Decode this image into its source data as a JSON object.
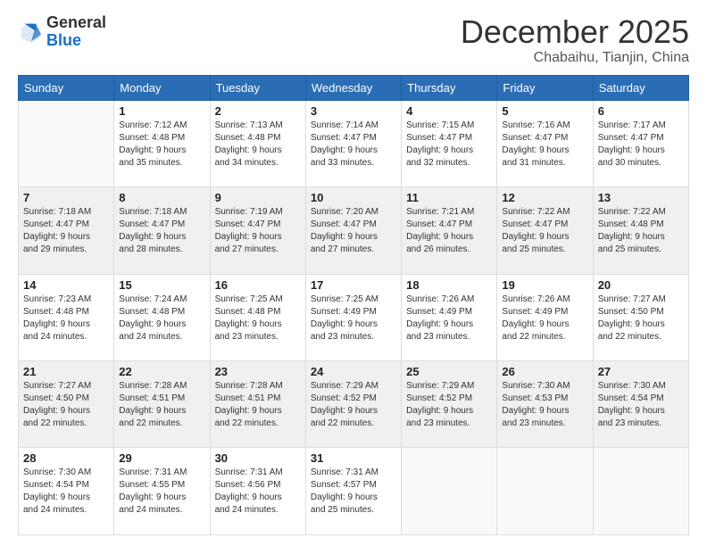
{
  "logo": {
    "general": "General",
    "blue": "Blue"
  },
  "title": "December 2025",
  "location": "Chabaihu, Tianjin, China",
  "weekdays": [
    "Sunday",
    "Monday",
    "Tuesday",
    "Wednesday",
    "Thursday",
    "Friday",
    "Saturday"
  ],
  "weeks": [
    [
      {
        "day": "",
        "empty": true
      },
      {
        "day": "1",
        "sunrise": "7:12 AM",
        "sunset": "4:48 PM",
        "daylight": "9 hours and 35 minutes."
      },
      {
        "day": "2",
        "sunrise": "7:13 AM",
        "sunset": "4:48 PM",
        "daylight": "9 hours and 34 minutes."
      },
      {
        "day": "3",
        "sunrise": "7:14 AM",
        "sunset": "4:47 PM",
        "daylight": "9 hours and 33 minutes."
      },
      {
        "day": "4",
        "sunrise": "7:15 AM",
        "sunset": "4:47 PM",
        "daylight": "9 hours and 32 minutes."
      },
      {
        "day": "5",
        "sunrise": "7:16 AM",
        "sunset": "4:47 PM",
        "daylight": "9 hours and 31 minutes."
      },
      {
        "day": "6",
        "sunrise": "7:17 AM",
        "sunset": "4:47 PM",
        "daylight": "9 hours and 30 minutes."
      }
    ],
    [
      {
        "day": "7",
        "sunrise": "7:18 AM",
        "sunset": "4:47 PM",
        "daylight": "9 hours and 29 minutes."
      },
      {
        "day": "8",
        "sunrise": "7:18 AM",
        "sunset": "4:47 PM",
        "daylight": "9 hours and 28 minutes."
      },
      {
        "day": "9",
        "sunrise": "7:19 AM",
        "sunset": "4:47 PM",
        "daylight": "9 hours and 27 minutes."
      },
      {
        "day": "10",
        "sunrise": "7:20 AM",
        "sunset": "4:47 PM",
        "daylight": "9 hours and 27 minutes."
      },
      {
        "day": "11",
        "sunrise": "7:21 AM",
        "sunset": "4:47 PM",
        "daylight": "9 hours and 26 minutes."
      },
      {
        "day": "12",
        "sunrise": "7:22 AM",
        "sunset": "4:47 PM",
        "daylight": "9 hours and 25 minutes."
      },
      {
        "day": "13",
        "sunrise": "7:22 AM",
        "sunset": "4:48 PM",
        "daylight": "9 hours and 25 minutes."
      }
    ],
    [
      {
        "day": "14",
        "sunrise": "7:23 AM",
        "sunset": "4:48 PM",
        "daylight": "9 hours and 24 minutes."
      },
      {
        "day": "15",
        "sunrise": "7:24 AM",
        "sunset": "4:48 PM",
        "daylight": "9 hours and 24 minutes."
      },
      {
        "day": "16",
        "sunrise": "7:25 AM",
        "sunset": "4:48 PM",
        "daylight": "9 hours and 23 minutes."
      },
      {
        "day": "17",
        "sunrise": "7:25 AM",
        "sunset": "4:49 PM",
        "daylight": "9 hours and 23 minutes."
      },
      {
        "day": "18",
        "sunrise": "7:26 AM",
        "sunset": "4:49 PM",
        "daylight": "9 hours and 23 minutes."
      },
      {
        "day": "19",
        "sunrise": "7:26 AM",
        "sunset": "4:49 PM",
        "daylight": "9 hours and 22 minutes."
      },
      {
        "day": "20",
        "sunrise": "7:27 AM",
        "sunset": "4:50 PM",
        "daylight": "9 hours and 22 minutes."
      }
    ],
    [
      {
        "day": "21",
        "sunrise": "7:27 AM",
        "sunset": "4:50 PM",
        "daylight": "9 hours and 22 minutes."
      },
      {
        "day": "22",
        "sunrise": "7:28 AM",
        "sunset": "4:51 PM",
        "daylight": "9 hours and 22 minutes."
      },
      {
        "day": "23",
        "sunrise": "7:28 AM",
        "sunset": "4:51 PM",
        "daylight": "9 hours and 22 minutes."
      },
      {
        "day": "24",
        "sunrise": "7:29 AM",
        "sunset": "4:52 PM",
        "daylight": "9 hours and 22 minutes."
      },
      {
        "day": "25",
        "sunrise": "7:29 AM",
        "sunset": "4:52 PM",
        "daylight": "9 hours and 23 minutes."
      },
      {
        "day": "26",
        "sunrise": "7:30 AM",
        "sunset": "4:53 PM",
        "daylight": "9 hours and 23 minutes."
      },
      {
        "day": "27",
        "sunrise": "7:30 AM",
        "sunset": "4:54 PM",
        "daylight": "9 hours and 23 minutes."
      }
    ],
    [
      {
        "day": "28",
        "sunrise": "7:30 AM",
        "sunset": "4:54 PM",
        "daylight": "9 hours and 24 minutes."
      },
      {
        "day": "29",
        "sunrise": "7:31 AM",
        "sunset": "4:55 PM",
        "daylight": "9 hours and 24 minutes."
      },
      {
        "day": "30",
        "sunrise": "7:31 AM",
        "sunset": "4:56 PM",
        "daylight": "9 hours and 24 minutes."
      },
      {
        "day": "31",
        "sunrise": "7:31 AM",
        "sunset": "4:57 PM",
        "daylight": "9 hours and 25 minutes."
      },
      {
        "day": "",
        "empty": true
      },
      {
        "day": "",
        "empty": true
      },
      {
        "day": "",
        "empty": true
      }
    ]
  ]
}
